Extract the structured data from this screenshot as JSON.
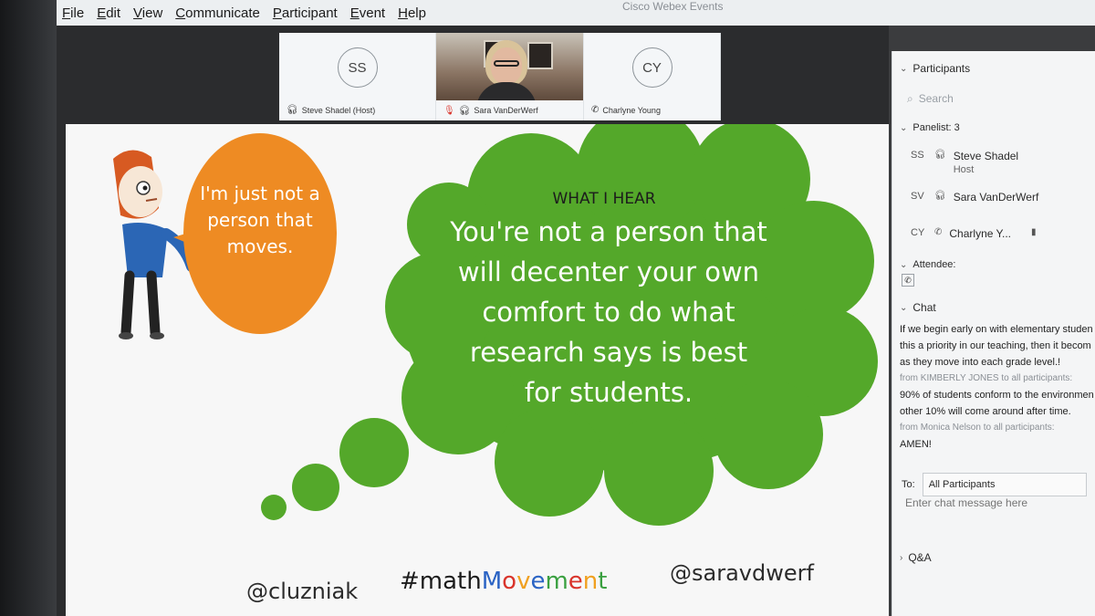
{
  "window_title": "Cisco Webex Events",
  "menu": [
    "File",
    "Edit",
    "View",
    "Communicate",
    "Participant",
    "Event",
    "Help"
  ],
  "video_tiles": [
    {
      "initials": "SS",
      "name": "Steve Shadel (Host)"
    },
    {
      "name": "Sara VanDerWerf"
    },
    {
      "initials": "CY",
      "name": "Charlyne Young"
    }
  ],
  "slide": {
    "left_bubble": "I'm just not a person that moves.",
    "right_label": "WHAT I HEAR",
    "right_bubble": "You're not a person that will decenter your own comfort to do what research says is best for students.",
    "footer_left": "@cluzniak",
    "footer_hashtag_prefix": "#math",
    "footer_hashtag_letters": [
      "M",
      "o",
      "v",
      "e",
      "m",
      "e",
      "n",
      "t"
    ],
    "footer_right": "@saravdwerf",
    "colors": {
      "orange": "#ee8b23",
      "green": "#54a82a",
      "hashtag_letters": [
        "#2a63c4",
        "#d9342b",
        "#f0a020",
        "#2a63c4",
        "#3aa040",
        "#d9342b",
        "#f0a020",
        "#3aa040"
      ]
    }
  },
  "panel": {
    "participants_header": "Participants",
    "search_placeholder": "Search",
    "panelist_header": "Panelist: 3",
    "panelists": [
      {
        "initials": "SS",
        "name": "Steve Shadel",
        "role": "Host"
      },
      {
        "initials": "SV",
        "name": "Sara VanDerWerf"
      },
      {
        "initials": "CY",
        "name": "Charlyne Y..."
      }
    ],
    "attendee_header": "Attendee:",
    "chat_header": "Chat",
    "chat_lines": [
      {
        "text": "If we begin early on with elementary studen",
        "from": false
      },
      {
        "text": "this a priority in our teaching, then it becom",
        "from": false
      },
      {
        "text": "as they move into each grade level.!",
        "from": false
      },
      {
        "text": "from KIMBERLY JONES to all participants:",
        "from": true
      },
      {
        "text": "90% of students conform to the environmen",
        "from": false
      },
      {
        "text": "other 10% will come around after time.",
        "from": false
      },
      {
        "text": "from Monica Nelson to all participants:",
        "from": true
      },
      {
        "text": "AMEN!",
        "from": false
      }
    ],
    "to_label": "To:",
    "to_value": "All Participants",
    "chat_placeholder": "Enter chat message here",
    "qa_header": "Q&A"
  }
}
